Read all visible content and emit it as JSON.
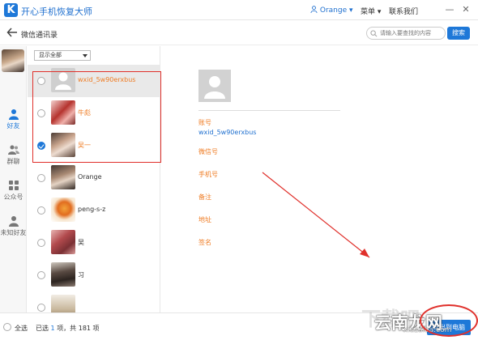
{
  "app": {
    "title": "开心手机恢复大师",
    "logo_letter": "K"
  },
  "titlebar": {
    "user": "Orange",
    "menu": "菜单",
    "contact": "联系我们",
    "minimize": "—",
    "close": "✕"
  },
  "header": {
    "title": "微信通讯录",
    "search_placeholder": "请输入要查找的内容",
    "search_button": "搜索"
  },
  "leftnav": {
    "items": [
      {
        "label": "好友",
        "icon": "person-icon",
        "active": true
      },
      {
        "label": "群聊",
        "icon": "group-icon",
        "active": false
      },
      {
        "label": "公众号",
        "icon": "grid-icon",
        "active": false
      },
      {
        "label": "未知好友",
        "icon": "unknown-person-icon",
        "active": false
      }
    ]
  },
  "list": {
    "filter": "显示全部",
    "contacts": [
      {
        "name": "wxid_5w90erxbus",
        "checked": false,
        "selected": true,
        "orange": true
      },
      {
        "name": "牛彪",
        "checked": false,
        "selected": false,
        "orange": true
      },
      {
        "name": "吴一",
        "checked": true,
        "selected": false,
        "orange": true
      },
      {
        "name": "Orange",
        "checked": false,
        "selected": false,
        "orange": false
      },
      {
        "name": "peng-s-z",
        "checked": false,
        "selected": false,
        "orange": false
      },
      {
        "name": "吴",
        "checked": false,
        "selected": false,
        "orange": false
      },
      {
        "name": "习",
        "checked": false,
        "selected": false,
        "orange": false
      },
      {
        "name": "",
        "checked": false,
        "selected": false,
        "orange": false
      }
    ]
  },
  "detail": {
    "account_label": "账号",
    "account_value": "wxid_5w90erxbus",
    "wechat_label": "微信号",
    "phone_label": "手机号",
    "remark_label": "备注",
    "region_label": "地址",
    "signature_label": "签名"
  },
  "footer": {
    "select_all": "全选",
    "count_prefix": "已选",
    "count_selected": "1",
    "count_suffix": "项，共 181 项",
    "export_button": "导出到电脑"
  },
  "watermark": {
    "line1": "下载吧",
    "line2": "云南龙网",
    "line3": "xiazaiba.com"
  },
  "colors": {
    "accent": "#1e78d8",
    "orange": "#ef7c24",
    "annotation_red": "#e0302b"
  }
}
